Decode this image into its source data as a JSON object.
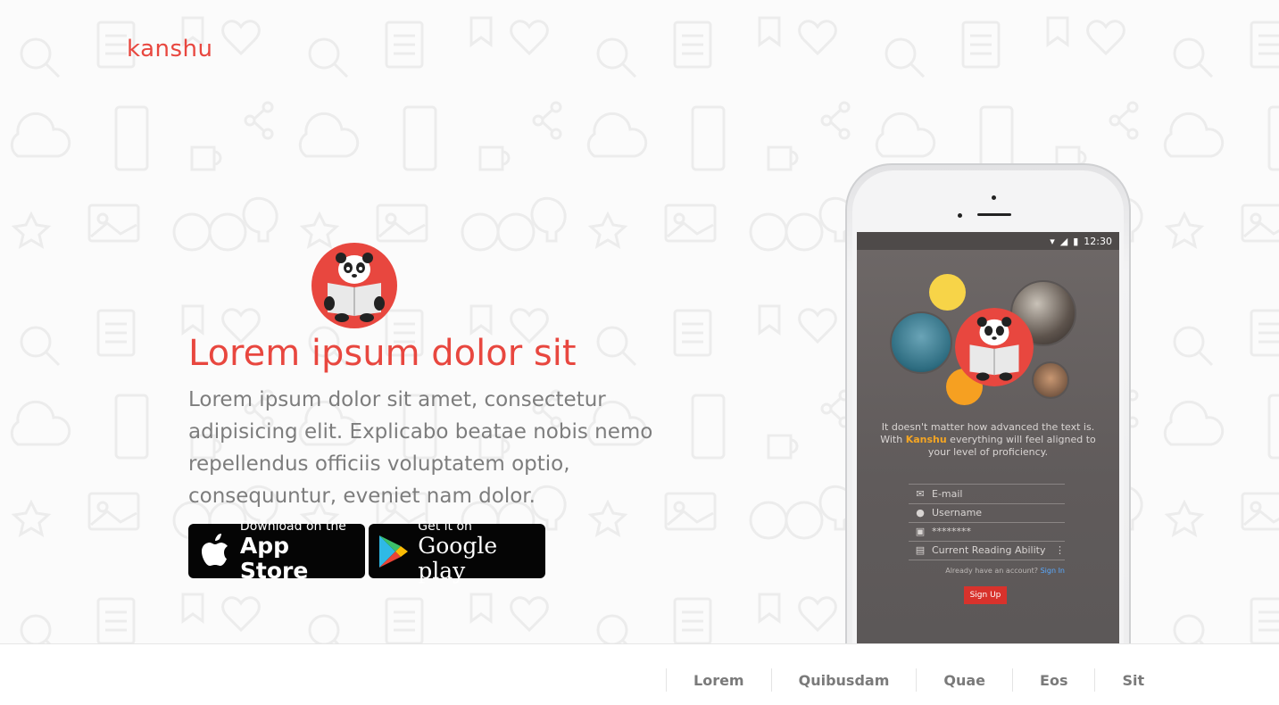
{
  "brand": {
    "name": "kanshu",
    "accent_color": "#e8473f"
  },
  "hero": {
    "title": "Lorem ipsum dolor sit",
    "description": "Lorem ipsum dolor sit amet, consectetur adipisicing elit. Explicabo beatae nobis nemo repellendus officiis voluptatem optio, consequuntur, eveniet nam dolor."
  },
  "store_buttons": {
    "apple": {
      "small": "Download on the",
      "big": "App Store",
      "icon": "apple-icon"
    },
    "google": {
      "small": "Get it on",
      "big": "Google play",
      "icon": "google-play-icon"
    }
  },
  "phone": {
    "status_time": "12:30",
    "tagline_pre": "It doesn't matter how advanced the text is. With ",
    "tagline_brand": "Kanshu",
    "tagline_post": " everything will feel aligned to your level of proficiency.",
    "fields": [
      {
        "icon": "mail-icon",
        "placeholder": "E-mail"
      },
      {
        "icon": "user-icon",
        "placeholder": "Username"
      },
      {
        "icon": "lock-icon",
        "placeholder": "********"
      },
      {
        "icon": "document-icon",
        "placeholder": "Current Reading Ability"
      }
    ],
    "signin_prompt": "Already have an account?",
    "signin_link": "Sign In",
    "signup_button": "Sign Up"
  },
  "footer_nav": [
    "Lorem",
    "Quibusdam",
    "Quae",
    "Eos",
    "Sit"
  ]
}
